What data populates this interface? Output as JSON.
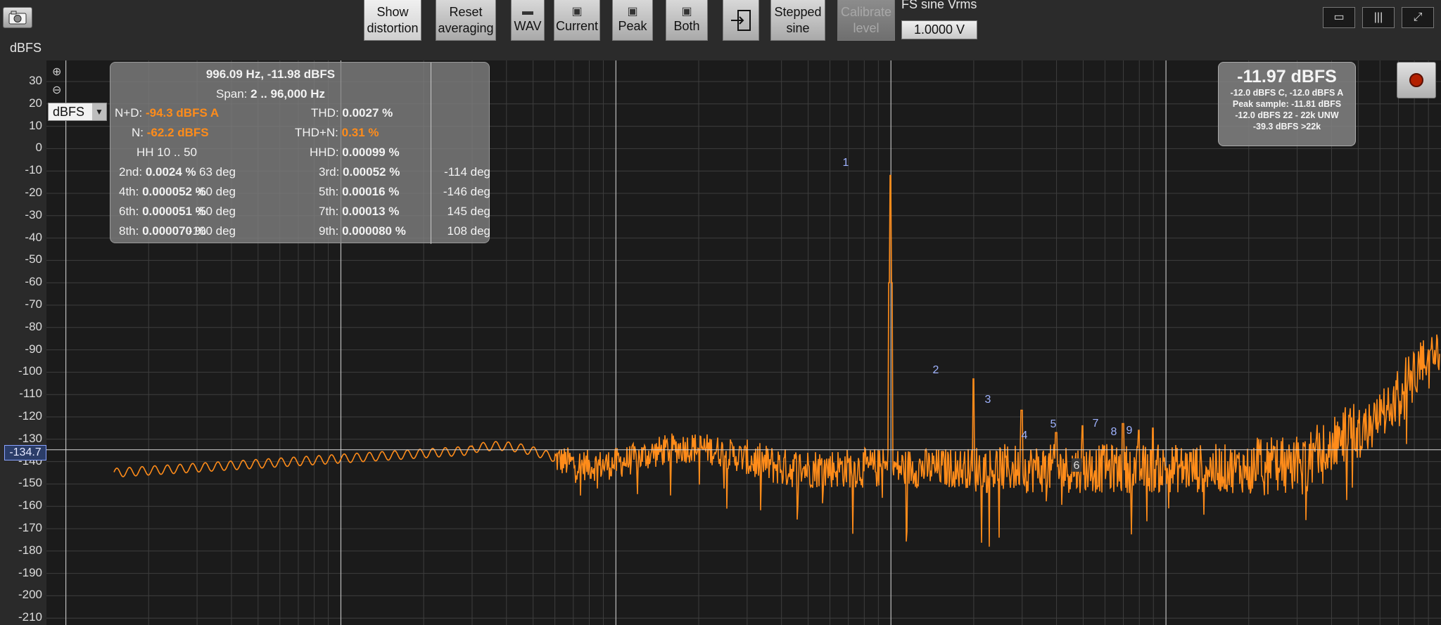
{
  "toolbar": {
    "show_distortion": [
      "Show",
      "distortion"
    ],
    "reset_averaging": [
      "Reset",
      "averaging"
    ],
    "wav": "WAV",
    "current": "Current",
    "peak": "Peak",
    "both": "Both",
    "stepped_sine": [
      "Stepped",
      "sine"
    ],
    "calibrate_level": [
      "Calibrate",
      "level"
    ],
    "fs_label": "FS sine Vrms",
    "fs_value": "1.0000 V"
  },
  "plot": {
    "y_unit": "dBFS",
    "unit_select": "dBFS",
    "cursor_readout": "-134.7",
    "cursor_value": -134.7,
    "y_ticks": [
      30,
      20,
      10,
      0,
      -10,
      -20,
      -30,
      -40,
      -50,
      -60,
      -70,
      -80,
      -90,
      -100,
      -110,
      -120,
      -130,
      -140,
      -150,
      -160,
      -170,
      -180,
      -190,
      -200,
      -210
    ],
    "harmonic_labels": [
      "1",
      "2",
      "3",
      "4",
      "5",
      "6",
      "7",
      "8",
      "9"
    ],
    "colors": {
      "trace": "#ff8c1a",
      "background": "#1b1b1b",
      "grid": "#3e3e3e",
      "cursor_line": "#d8d8d8"
    }
  },
  "distortion": {
    "header": "996.09 Hz, -11.98 dBFS",
    "span_label": "Span:",
    "span_value": "2 .. 96,000 Hz",
    "nd_label": "N+D:",
    "nd_value": "-94.3 dBFS A",
    "thd_label": "THD:",
    "thd_value": "0.0027 %",
    "n_label": "N:",
    "n_value": "-62.2 dBFS",
    "thdn_label": "THD+N:",
    "thdn_value": "0.31 %",
    "hh": "HH 10 .. 50",
    "hhd_label": "HHD:",
    "hhd_value": "0.00099 %",
    "harmonics": [
      {
        "label": "2nd:",
        "value": "0.0024 %",
        "phase": "63 deg"
      },
      {
        "label": "3rd:",
        "value": "0.00052 %",
        "phase": "-114 deg"
      },
      {
        "label": "4th:",
        "value": "0.000052 %",
        "phase": "-60 deg"
      },
      {
        "label": "5th:",
        "value": "0.00016 %",
        "phase": "-146 deg"
      },
      {
        "label": "6th:",
        "value": "0.000051 %",
        "phase": "-50 deg"
      },
      {
        "label": "7th:",
        "value": "0.00013 %",
        "phase": "145 deg"
      },
      {
        "label": "8th:",
        "value": "0.000070 %",
        "phase": "-100 deg"
      },
      {
        "label": "9th:",
        "value": "0.000080 %",
        "phase": "108 deg"
      }
    ]
  },
  "level": {
    "main": "-11.97 dBFS",
    "line1": "-12.0 dBFS C, -12.0 dBFS A",
    "line2": "Peak sample: -11.81 dBFS",
    "line3": "-12.0 dBFS 22 - 22k UNW",
    "line4": "-39.3 dBFS >22k"
  },
  "icons": {
    "camera": "camera-icon",
    "record": "record-icon",
    "zoom_in": "zoom-in-icon",
    "zoom_out": "zoom-out-icon"
  }
}
